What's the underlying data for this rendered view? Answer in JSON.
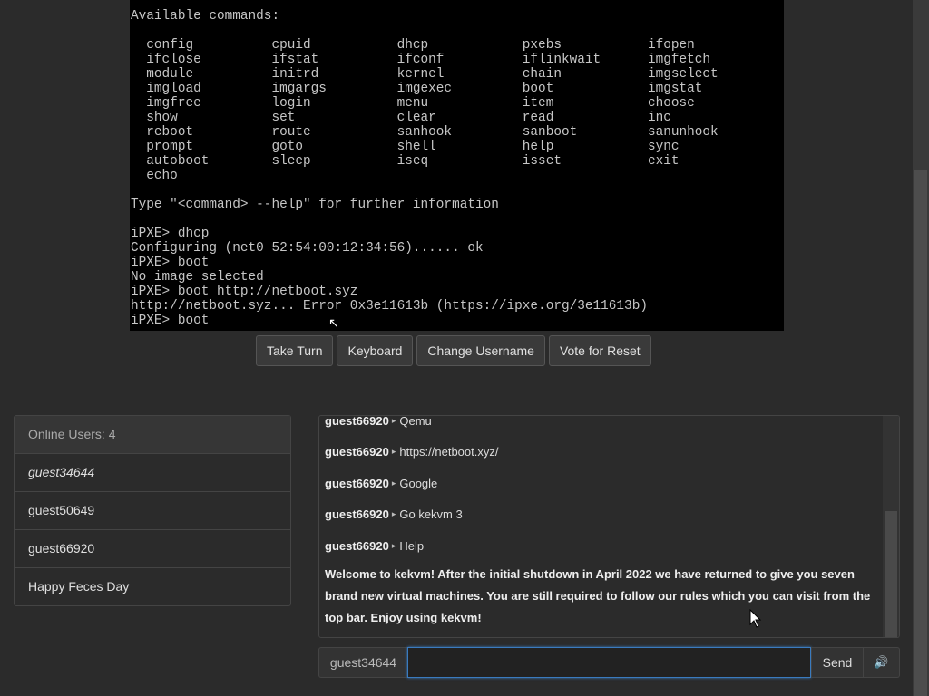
{
  "vm": {
    "lines": [
      "Available commands:",
      "",
      "  config          cpuid           dhcp            pxebs           ifopen",
      "  ifclose         ifstat          ifconf          iflinkwait      imgfetch",
      "  module          initrd          kernel          chain           imgselect",
      "  imgload         imgargs         imgexec         boot            imgstat",
      "  imgfree         login           menu            item            choose",
      "  show            set             clear           read            inc",
      "  reboot          route           sanhook         sanboot         sanunhook",
      "  prompt          goto            shell           help            sync",
      "  autoboot        sleep           iseq            isset           exit",
      "  echo",
      "",
      "Type \"<command> --help\" for further information",
      "",
      "iPXE> dhcp",
      "Configuring (net0 52:54:00:12:34:56)...... ok",
      "iPXE> boot",
      "No image selected",
      "iPXE> boot http://netboot.syz",
      "http://netboot.syz... Error 0x3e11613b (https://ipxe.org/3e11613b)",
      "iPXE> boot"
    ]
  },
  "buttons": {
    "take_turn": "Take Turn",
    "keyboard": "Keyboard",
    "change_username": "Change Username",
    "vote_reset": "Vote for Reset"
  },
  "users": {
    "header": "Online Users: 4",
    "list": [
      "guest34644",
      "guest50649",
      "guest66920",
      "Happy Feces Day"
    ]
  },
  "chat": {
    "messages": [
      {
        "user": "guest66920",
        "text": "Qemu"
      },
      {
        "user": "guest66920",
        "text": "https://netboot.xyz/"
      },
      {
        "user": "guest66920",
        "text": "Google"
      },
      {
        "user": "guest66920",
        "text": "Go kekvm 3"
      },
      {
        "user": "guest66920",
        "text": "Help"
      }
    ],
    "system": "Welcome to kekvm! After the initial shutdown in April 2022 we have returned to give you seven brand new virtual machines. You are still required to follow our rules which you can visit from the top bar. Enjoy using kekvm!"
  },
  "input": {
    "username": "guest34644",
    "value": "",
    "send_label": "Send",
    "sound_icon": "🔊"
  },
  "colors": {
    "background": "#2b2b2b",
    "vm_text": "#c6c6c6",
    "focus": "#3a7bbf"
  }
}
